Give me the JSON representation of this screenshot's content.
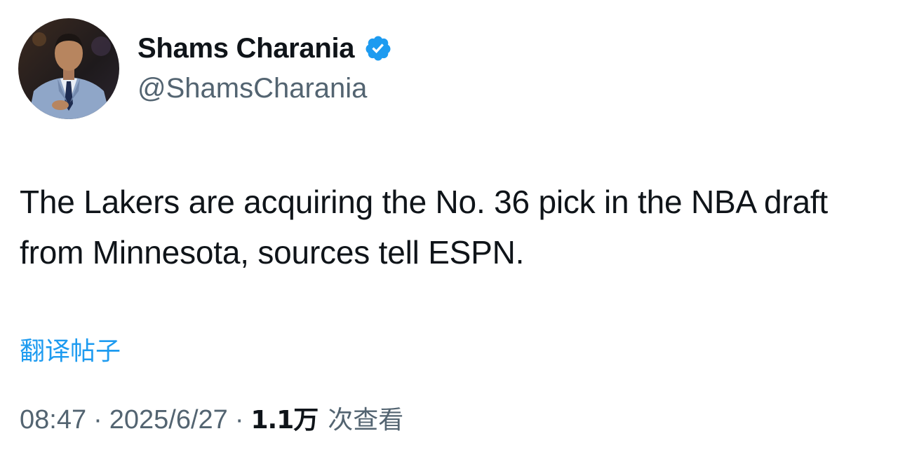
{
  "author": {
    "display_name": "Shams Charania",
    "handle": "@ShamsCharania",
    "verified": true,
    "verified_color": "#1d9bf0"
  },
  "tweet": {
    "text": "The Lakers are acquiring the No. 36 pick in the NBA draft from Minnesota, sources tell ESPN.",
    "translate_label": "翻译帖子",
    "time": "08:47",
    "date": "2025/6/27",
    "separator": "·",
    "views_count": "1.1万",
    "views_label": "次查看"
  },
  "colors": {
    "text_primary": "#0f1419",
    "text_secondary": "#536471",
    "link": "#1d9bf0"
  }
}
